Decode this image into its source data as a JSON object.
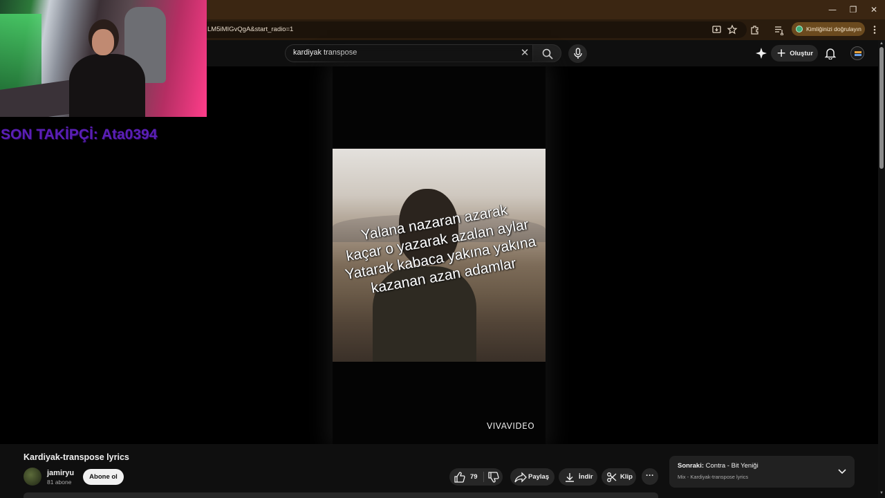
{
  "browser": {
    "url_fragment": "LM5iMIGvQgA&start_radio=1",
    "verify_label": "Kimliğinizi doğrulayın",
    "window_controls": [
      "—",
      "❐",
      "✕"
    ]
  },
  "masthead": {
    "search_query": "kardiyak transpose",
    "create_label": "Oluştur"
  },
  "overlay": {
    "follower_text": "SON TAKİPÇİ: Ata0394"
  },
  "video": {
    "lyrics": [
      "Yalana nazaran azarak",
      "kaçar o yazarak azalan aylar",
      "Yatarak kabaca yakına yakına",
      "kazanan azan adamlar"
    ],
    "watermark": "VIVAVIDEO"
  },
  "details": {
    "title": "Kardiyak-transpose lyrics",
    "channel_name": "jamiryu",
    "subscribers": "81 abone",
    "subscribe_label": "Abone ol",
    "like_count": "79",
    "share_label": "Paylaş",
    "download_label": "İndir",
    "clip_label": "Klip",
    "more_label": "···"
  },
  "up_next": {
    "prefix": "Sonraki:",
    "title": "Contra - Bit Yeniği",
    "subtitle": "Mix - Kardiyak-transpose lyrics"
  },
  "colors": {
    "titlebar": "#3b2612",
    "follower_text": "#5a1fb5",
    "page_bg": "#0f0f0f",
    "pill_bg": "#272727"
  },
  "icons": [
    "minimize-icon",
    "restore-icon",
    "close-icon",
    "install-app-icon",
    "bookmark-star-icon",
    "extensions-icon",
    "media-queue-icon",
    "chrome-menu-icon",
    "search-icon",
    "clear-icon",
    "mic-icon",
    "sparkle-icon",
    "plus-icon",
    "bell-icon",
    "like-icon",
    "dislike-icon",
    "share-icon",
    "download-icon",
    "scissors-icon",
    "chevron-down-icon"
  ]
}
